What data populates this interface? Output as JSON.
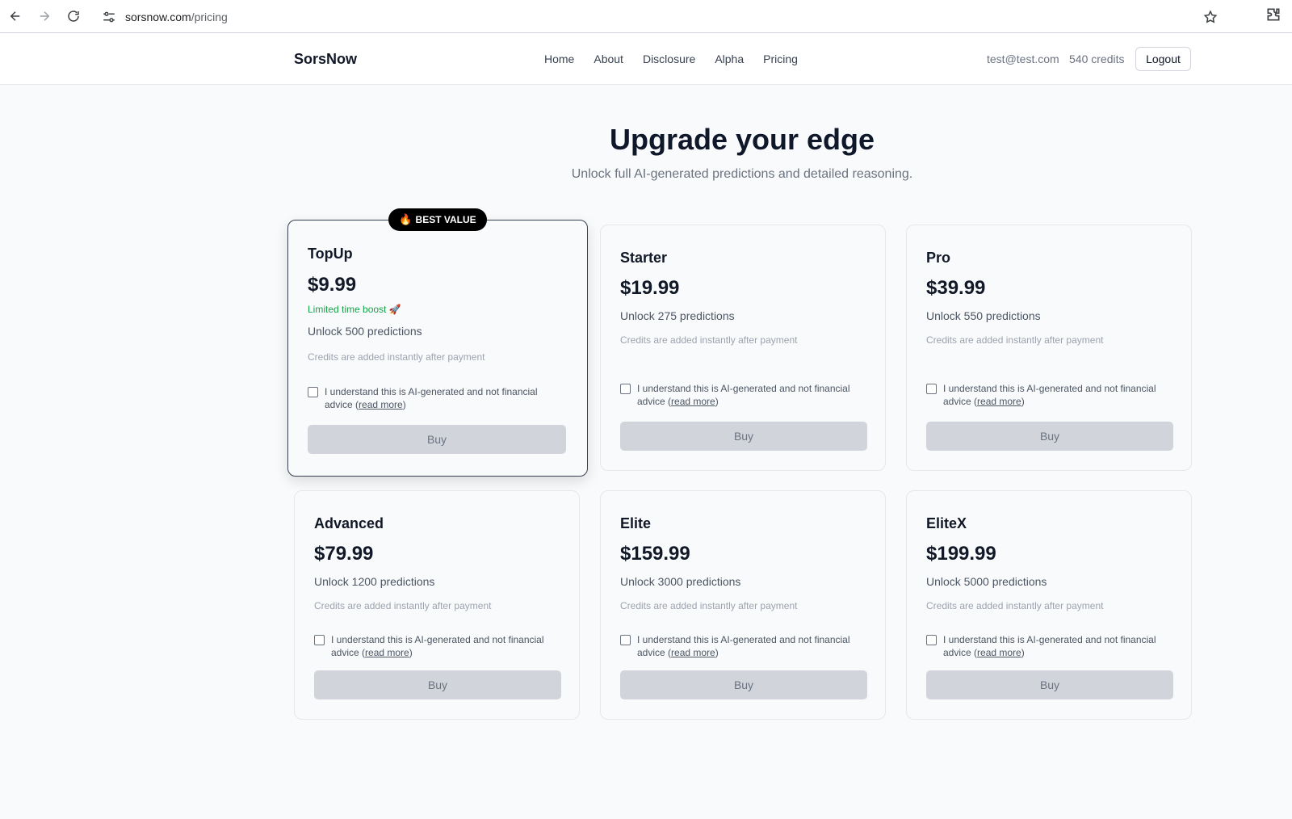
{
  "browser": {
    "url_host": "sorsnow.com",
    "url_path": "/pricing"
  },
  "header": {
    "brand": "SorsNow",
    "nav": [
      "Home",
      "About",
      "Disclosure",
      "Alpha",
      "Pricing"
    ],
    "user_email": "test@test.com",
    "credits": "540 credits",
    "logout_label": "Logout"
  },
  "hero": {
    "title": "Upgrade your edge",
    "subtitle": "Unlock full AI-generated predictions and detailed reasoning."
  },
  "badge": {
    "icon": "fire-icon",
    "label": "BEST VALUE"
  },
  "plans": [
    {
      "name": "TopUp",
      "price": "$9.99",
      "boost": "Limited time boost 🚀",
      "unlock": "Unlock 500 predictions",
      "note": "Credits are added instantly after payment",
      "agree_text": "I understand this is AI-generated and not financial advice (",
      "read_more": "read more",
      "agree_close": ")",
      "buy_label": "Buy"
    },
    {
      "name": "Starter",
      "price": "$19.99",
      "unlock": "Unlock 275 predictions",
      "note": "Credits are added instantly after payment",
      "agree_text": "I understand this is AI-generated and not financial advice (",
      "read_more": "read more",
      "agree_close": ")",
      "buy_label": "Buy"
    },
    {
      "name": "Pro",
      "price": "$39.99",
      "unlock": "Unlock 550 predictions",
      "note": "Credits are added instantly after payment",
      "agree_text": "I understand this is AI-generated and not financial advice (",
      "read_more": "read more",
      "agree_close": ")",
      "buy_label": "Buy"
    },
    {
      "name": "Advanced",
      "price": "$79.99",
      "unlock": "Unlock 1200 predictions",
      "note": "Credits are added instantly after payment",
      "agree_text": "I understand this is AI-generated and not financial advice (",
      "read_more": "read more",
      "agree_close": ")",
      "buy_label": "Buy"
    },
    {
      "name": "Elite",
      "price": "$159.99",
      "unlock": "Unlock 3000 predictions",
      "note": "Credits are added instantly after payment",
      "agree_text": "I understand this is AI-generated and not financial advice (",
      "read_more": "read more",
      "agree_close": ")",
      "buy_label": "Buy"
    },
    {
      "name": "EliteX",
      "price": "$199.99",
      "unlock": "Unlock 5000 predictions",
      "note": "Credits are added instantly after payment",
      "agree_text": "I understand this is AI-generated and not financial advice (",
      "read_more": "read more",
      "agree_close": ")",
      "buy_label": "Buy"
    }
  ]
}
